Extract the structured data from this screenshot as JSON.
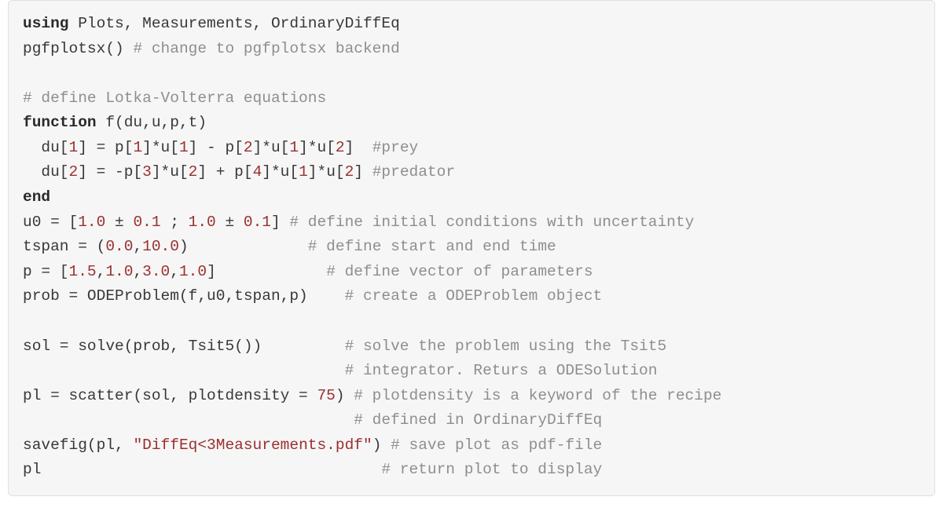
{
  "lines": [
    [
      [
        "kw",
        "using"
      ],
      [
        "",
        " Plots, Measurements, OrdinaryDiffEq"
      ]
    ],
    [
      [
        "",
        "pgfplotsx() "
      ],
      [
        "cm",
        "# change to pgfplotsx backend"
      ]
    ],
    [
      [
        "",
        ""
      ]
    ],
    [
      [
        "cm",
        "# define Lotka-Volterra equations"
      ]
    ],
    [
      [
        "kw",
        "function"
      ],
      [
        "",
        " f(du,u,p,t)"
      ]
    ],
    [
      [
        "",
        "  du["
      ],
      [
        "nm",
        "1"
      ],
      [
        "",
        "] = p["
      ],
      [
        "nm",
        "1"
      ],
      [
        "",
        "]*u["
      ],
      [
        "nm",
        "1"
      ],
      [
        "",
        "] - p["
      ],
      [
        "nm",
        "2"
      ],
      [
        "",
        "]*u["
      ],
      [
        "nm",
        "1"
      ],
      [
        "",
        "]*u["
      ],
      [
        "nm",
        "2"
      ],
      [
        "",
        "]  "
      ],
      [
        "cm",
        "#prey"
      ]
    ],
    [
      [
        "",
        "  du["
      ],
      [
        "nm",
        "2"
      ],
      [
        "",
        "] = -p["
      ],
      [
        "nm",
        "3"
      ],
      [
        "",
        "]*u["
      ],
      [
        "nm",
        "2"
      ],
      [
        "",
        "] + p["
      ],
      [
        "nm",
        "4"
      ],
      [
        "",
        "]*u["
      ],
      [
        "nm",
        "1"
      ],
      [
        "",
        "]*u["
      ],
      [
        "nm",
        "2"
      ],
      [
        "",
        "] "
      ],
      [
        "cm",
        "#predator"
      ]
    ],
    [
      [
        "kw",
        "end"
      ]
    ],
    [
      [
        "",
        "u0 = ["
      ],
      [
        "nm",
        "1.0"
      ],
      [
        "",
        " ± "
      ],
      [
        "nm",
        "0.1"
      ],
      [
        "",
        " ; "
      ],
      [
        "nm",
        "1.0"
      ],
      [
        "",
        " ± "
      ],
      [
        "nm",
        "0.1"
      ],
      [
        "",
        "] "
      ],
      [
        "cm",
        "# define initial conditions with uncertainty"
      ]
    ],
    [
      [
        "",
        "tspan = ("
      ],
      [
        "nm",
        "0.0"
      ],
      [
        "",
        ","
      ],
      [
        "nm",
        "10.0"
      ],
      [
        "",
        ")             "
      ],
      [
        "cm",
        "# define start and end time"
      ]
    ],
    [
      [
        "",
        "p = ["
      ],
      [
        "nm",
        "1.5"
      ],
      [
        "",
        ","
      ],
      [
        "nm",
        "1.0"
      ],
      [
        "",
        ","
      ],
      [
        "nm",
        "3.0"
      ],
      [
        "",
        ","
      ],
      [
        "nm",
        "1.0"
      ],
      [
        "",
        "]            "
      ],
      [
        "cm",
        "# define vector of parameters"
      ]
    ],
    [
      [
        "",
        "prob = ODEProblem(f,u0,tspan,p)    "
      ],
      [
        "cm",
        "# create a ODEProblem object"
      ]
    ],
    [
      [
        "",
        ""
      ]
    ],
    [
      [
        "",
        "sol = solve(prob, Tsit5())         "
      ],
      [
        "cm",
        "# solve the problem using the Tsit5"
      ]
    ],
    [
      [
        "",
        "                                   "
      ],
      [
        "cm",
        "# integrator. Returs a ODESolution"
      ]
    ],
    [
      [
        "",
        "pl = scatter(sol, plotdensity = "
      ],
      [
        "nm",
        "75"
      ],
      [
        "",
        ") "
      ],
      [
        "cm",
        "# plotdensity is a keyword of the recipe"
      ]
    ],
    [
      [
        "",
        "                                    "
      ],
      [
        "cm",
        "# defined in OrdinaryDiffEq"
      ]
    ],
    [
      [
        "",
        "savefig(pl, "
      ],
      [
        "st",
        "\"DiffEq<3Measurements.pdf\""
      ],
      [
        "",
        ") "
      ],
      [
        "cm",
        "# save plot as pdf-file"
      ]
    ],
    [
      [
        "",
        "pl                                     "
      ],
      [
        "cm",
        "# return plot to display"
      ]
    ]
  ]
}
